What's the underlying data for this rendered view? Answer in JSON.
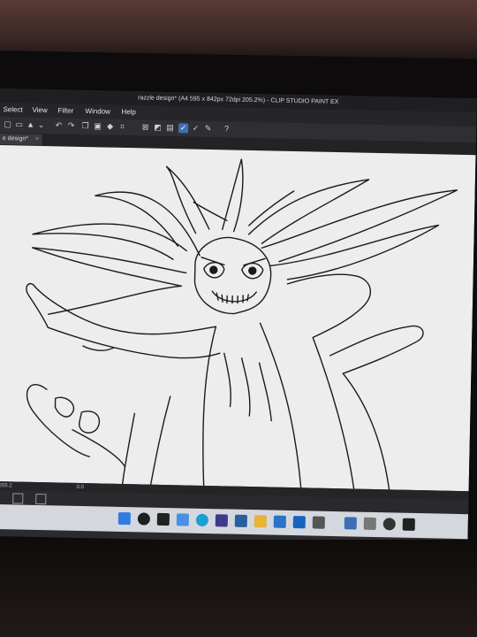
{
  "window": {
    "title": "razzle design* (A4 595 x 842px 72dpi 205.2%)  - CLIP STUDIO PAINT EX"
  },
  "menu": {
    "items": [
      {
        "label": "Select"
      },
      {
        "label": "View"
      },
      {
        "label": "Filter"
      },
      {
        "label": "Window"
      },
      {
        "label": "Help"
      }
    ]
  },
  "tabs": [
    {
      "label": "e design*",
      "close": "×"
    }
  ],
  "status": {
    "zoom": "205.2",
    "angle": "0.0"
  },
  "toolbar": {
    "icons": [
      "new-icon",
      "open-icon",
      "save-icon",
      "chevron-down-icon",
      "undo-icon",
      "redo-icon",
      "copy-icon",
      "paste-icon",
      "fill-icon",
      "crop-icon",
      "grid-icon",
      "snap-icon",
      "ruler-icon",
      "checkmark-icon",
      "checkmark-icon",
      "pen-icon",
      "help-icon"
    ]
  },
  "taskbar": {
    "icons": [
      "windows-start-icon",
      "search-icon",
      "task-view-icon",
      "widgets-icon",
      "edge-icon",
      "calendar-icon",
      "store-icon",
      "explorer-icon",
      "mail-icon",
      "dropbox-icon",
      "settings-icon",
      "clip-studio-icon",
      "photos-icon",
      "app-icon",
      "paint-icon"
    ]
  },
  "colors": {
    "accent": "#3d6fb6",
    "canvas": "#ededed",
    "taskbar": "#d4d8de"
  }
}
